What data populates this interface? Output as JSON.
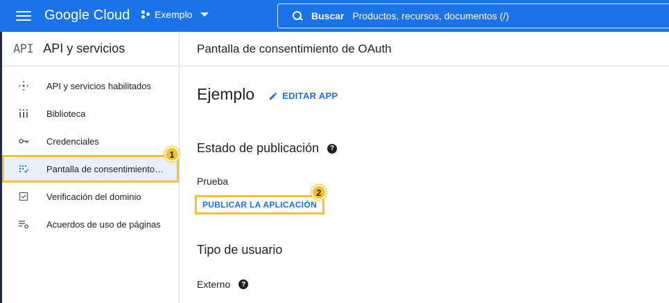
{
  "header": {
    "logo": "Google Cloud",
    "project": "Exemplo",
    "search_label": "Buscar",
    "search_placeholder": "Productos, recursos, documentos (/)"
  },
  "sidebar": {
    "logo_text": "API",
    "title": "API y servicios",
    "items": [
      {
        "label": "API y servicios habilitados",
        "icon": "api-icon"
      },
      {
        "label": "Biblioteca",
        "icon": "library-icon"
      },
      {
        "label": "Credenciales",
        "icon": "key-icon"
      },
      {
        "label": "Pantalla de consentimiento de OAuth",
        "icon": "consent-icon",
        "active": true
      },
      {
        "label": "Verificación del dominio",
        "icon": "checkbox-icon"
      },
      {
        "label": "Acuerdos de uso de páginas",
        "icon": "settings-list-icon"
      }
    ]
  },
  "content": {
    "page_title": "Pantalla de consentimiento de OAuth",
    "app_name": "Ejemplo",
    "edit_label": "EDITAR APP",
    "publish_status_title": "Estado de publicación",
    "publish_status_value": "Prueba",
    "publish_button": "PUBLICAR LA APLICACIÓN",
    "user_type_title": "Tipo de usuario",
    "user_type_value": "Externo"
  },
  "annotations": {
    "badge_1": "1",
    "badge_2": "2"
  },
  "colors": {
    "accent": "#1a73e8",
    "highlight": "#fbc12d",
    "active_bg": "#e8f0fe"
  }
}
